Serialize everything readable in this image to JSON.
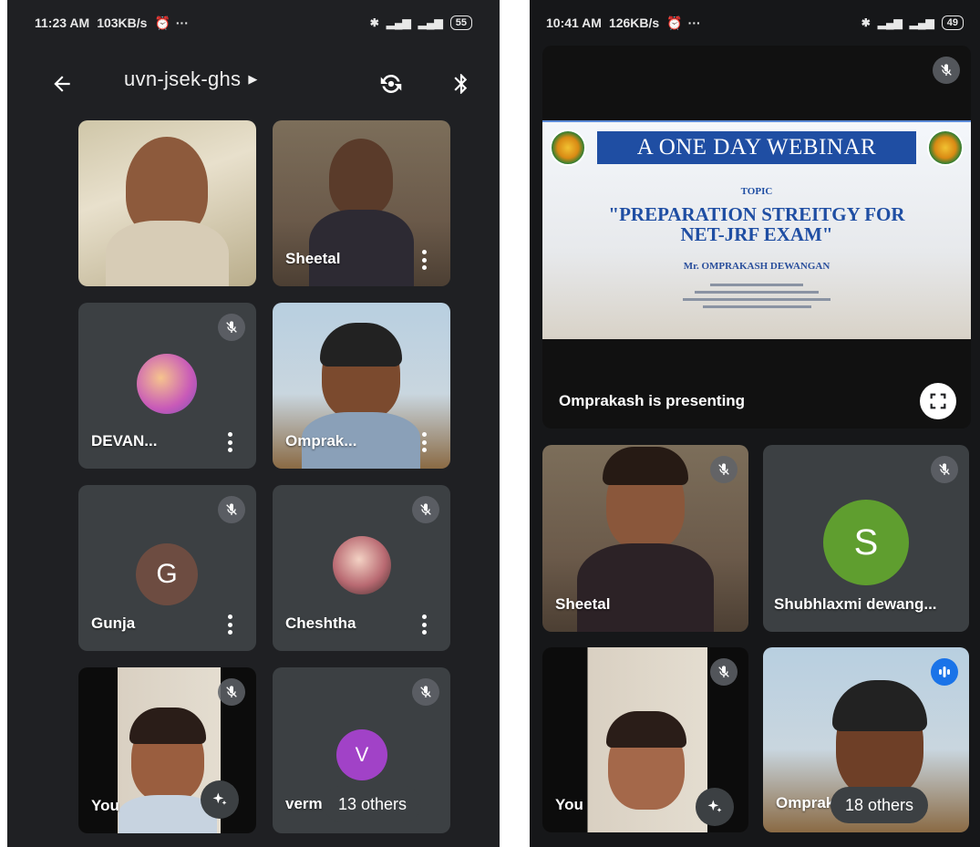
{
  "left_screen": {
    "status": {
      "time": "11:23 AM",
      "speed": "103KB/s",
      "dots": "···",
      "battery": "55"
    },
    "meeting": {
      "code": "uvn-jsek-ghs"
    },
    "participants": [
      {
        "name": "",
        "muted": false
      },
      {
        "name": "Sheetal",
        "muted": false
      },
      {
        "name": "DEVAN...",
        "muted": true
      },
      {
        "name": "Omprak...",
        "muted": false
      },
      {
        "name": "Gunja",
        "muted": true,
        "initial": "G",
        "avatar_color": "#6d4c41"
      },
      {
        "name": "Cheshtha",
        "muted": true
      },
      {
        "name": "You",
        "muted": true
      },
      {
        "name": "verm",
        "muted": true,
        "initial": "V",
        "avatar_color": "#a142c7"
      }
    ],
    "others_label": "13 others"
  },
  "right_screen": {
    "status": {
      "time": "10:41 AM",
      "speed": "126KB/s",
      "dots": "···",
      "battery": "49"
    },
    "presentation": {
      "banner": "A ONE DAY WEBINAR",
      "topic": "TOPIC",
      "headline_line1": "\"PREPARATION STREITGY FOR",
      "headline_line2": "NET-JRF EXAM\"",
      "presenter": "Mr. OMPRAKASH DEWANGAN",
      "presenting_label": "Omprakash is presenting"
    },
    "participants": [
      {
        "name": "Sheetal",
        "muted": true
      },
      {
        "name": "Shubhlaxmi dewang...",
        "muted": true,
        "initial": "S",
        "avatar_color": "#5f9e2f"
      },
      {
        "name": "You",
        "muted": true
      },
      {
        "name": "Omprak",
        "speaking": true
      }
    ],
    "others_label": "18 others"
  },
  "colors": {
    "app_bg": "#1f2023",
    "tile_bg": "#3c4043",
    "accent_blue": "#1a73e8"
  }
}
